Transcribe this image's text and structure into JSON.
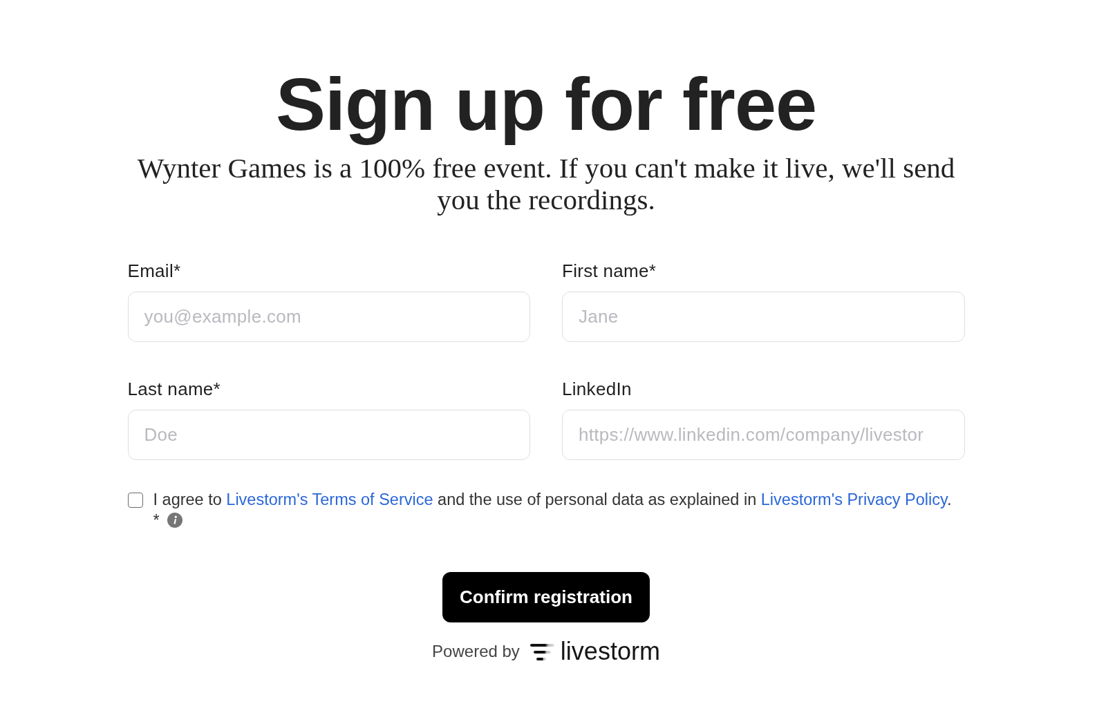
{
  "heading": "Sign up for free",
  "subheading": "Wynter Games is a 100% free event. If you can't make it live, we'll send you the recordings.",
  "fields": [
    {
      "label": "Email*",
      "placeholder": "you@example.com"
    },
    {
      "label": "First name*",
      "placeholder": "Jane"
    },
    {
      "label": "Last name*",
      "placeholder": "Doe"
    },
    {
      "label": "LinkedIn",
      "placeholder": "https://www.linkedin.com/company/livestor"
    }
  ],
  "consent": {
    "checked": false,
    "segments": [
      {
        "kind": "text",
        "text": "I agree to "
      },
      {
        "kind": "link",
        "text": "Livestorm's Terms of Service"
      },
      {
        "kind": "text",
        "text": " and the use of personal data as explained in "
      },
      {
        "kind": "link",
        "text": "Livestorm's Privacy Policy"
      },
      {
        "kind": "text",
        "text": "."
      }
    ],
    "required_mark": "*"
  },
  "submit_button": "Confirm registration",
  "footer": {
    "powered_by": "Powered by",
    "brand": "livestorm"
  }
}
